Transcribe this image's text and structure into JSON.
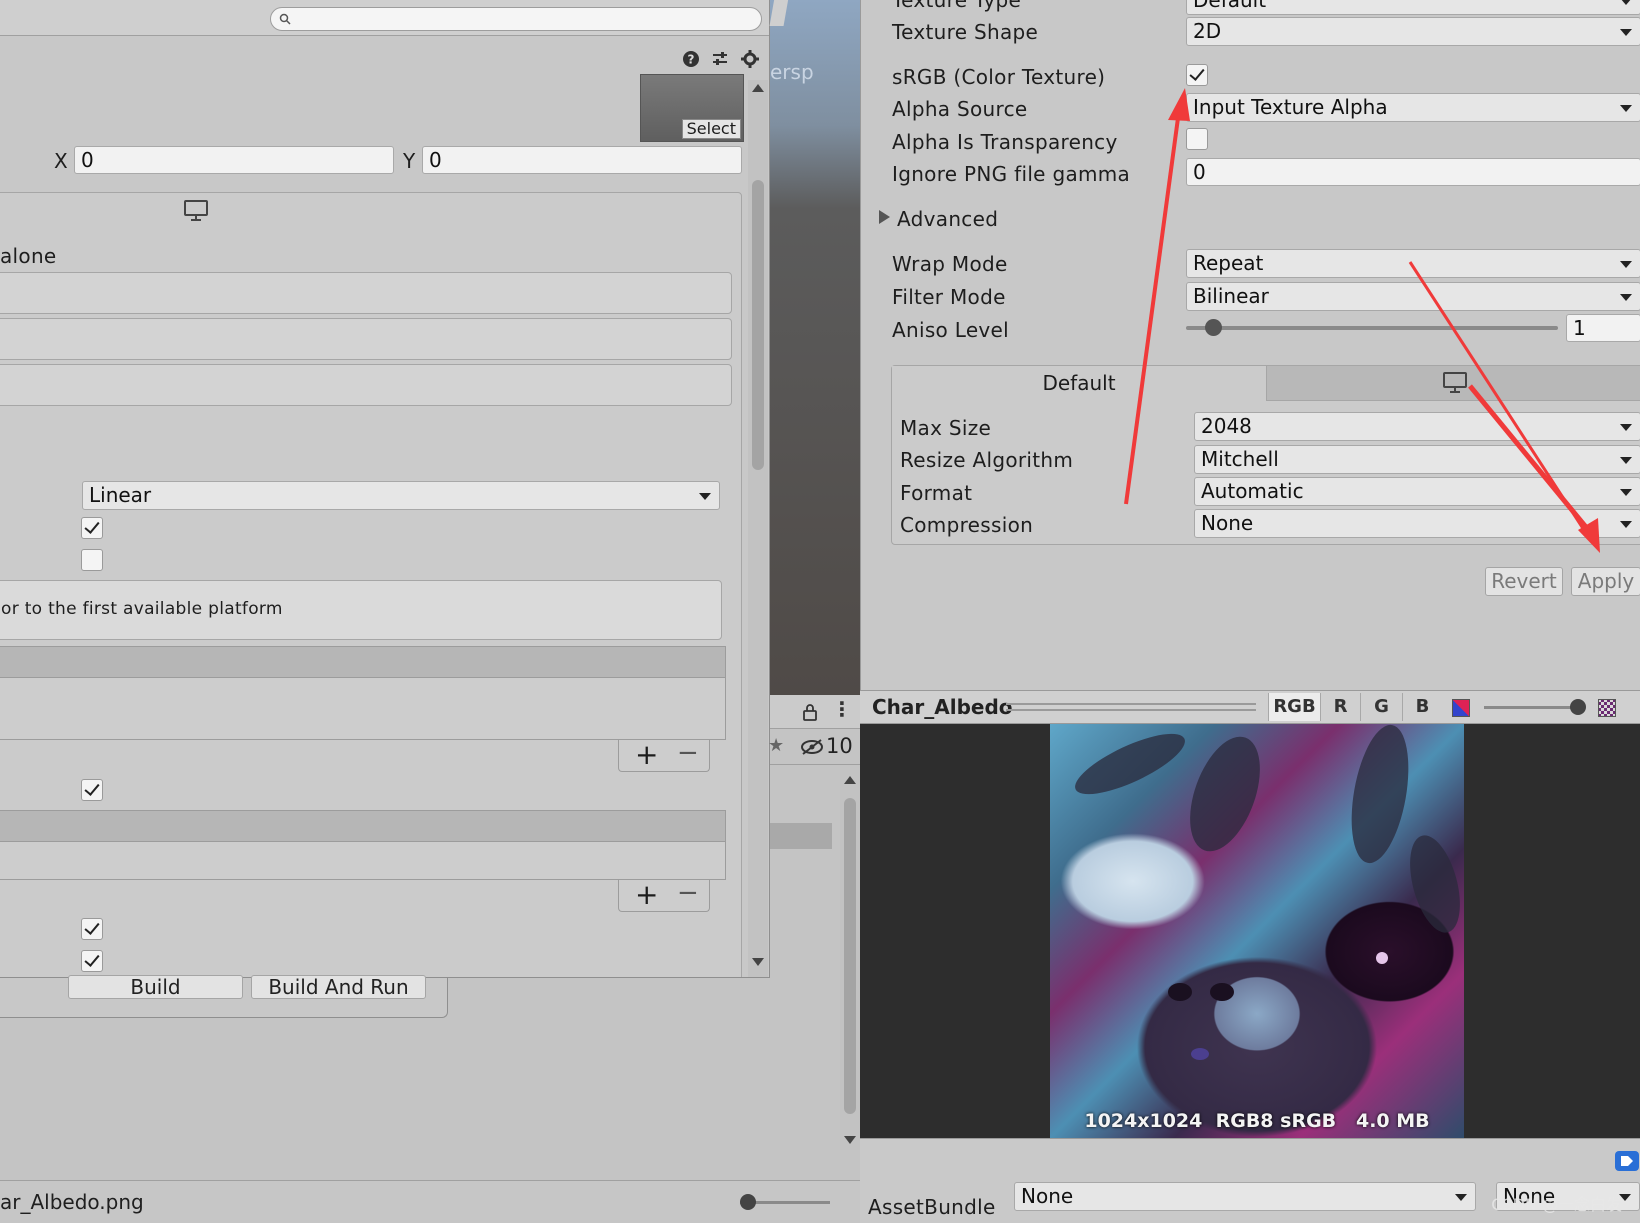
{
  "left_window": {
    "sprite_select_label": "Select",
    "x_label": "X",
    "x_value": "0",
    "y_label": "Y",
    "y_value": "0",
    "platform_tab_partial": "alone",
    "color_space_value": "Linear",
    "platform_message_partial": "or to the first available platform",
    "build_button": "Build",
    "build_and_run_button": "Build And Run"
  },
  "scene": {
    "persp_label_partial": "ersp",
    "hidden_count": "10"
  },
  "inspector": {
    "texture_type_label": "Texture Type",
    "texture_type_value": "Default",
    "texture_shape_label": "Texture Shape",
    "texture_shape_value": "2D",
    "srgb_label": "sRGB (Color Texture)",
    "alpha_source_label": "Alpha Source",
    "alpha_source_value": "Input Texture Alpha",
    "alpha_transparency_label": "Alpha Is Transparency",
    "ignore_png_gamma_label": "Ignore PNG file gamma",
    "ignore_png_gamma_value": "0",
    "advanced_label": "Advanced",
    "wrap_mode_label": "Wrap Mode",
    "wrap_mode_value": "Repeat",
    "filter_mode_label": "Filter Mode",
    "filter_mode_value": "Bilinear",
    "aniso_level_label": "Aniso Level",
    "aniso_level_value": "1",
    "platform_tab_default": "Default",
    "max_size_label": "Max Size",
    "max_size_value": "2048",
    "resize_algorithm_label": "Resize Algorithm",
    "resize_algorithm_value": "Mitchell",
    "format_label": "Format",
    "format_value": "Automatic",
    "compression_label": "Compression",
    "compression_value": "None",
    "revert_button": "Revert",
    "apply_button": "Apply"
  },
  "preview": {
    "asset_name": "Char_Albedo",
    "channel_rgb": "RGB",
    "channel_r": "R",
    "channel_g": "G",
    "channel_b": "B",
    "texture_info": "1024x1024  RGB8 sRGB   4.0 MB"
  },
  "assetbundle": {
    "label": "AssetBundle",
    "name_value": "None",
    "variant_value": "None"
  },
  "status": {
    "file_name_partial": "ar_Albedo.png"
  },
  "watermark": "CSDN @一念白发",
  "colors": {
    "annotation_arrow": "#f03a3a",
    "preview_background": "#2d2d2d"
  }
}
